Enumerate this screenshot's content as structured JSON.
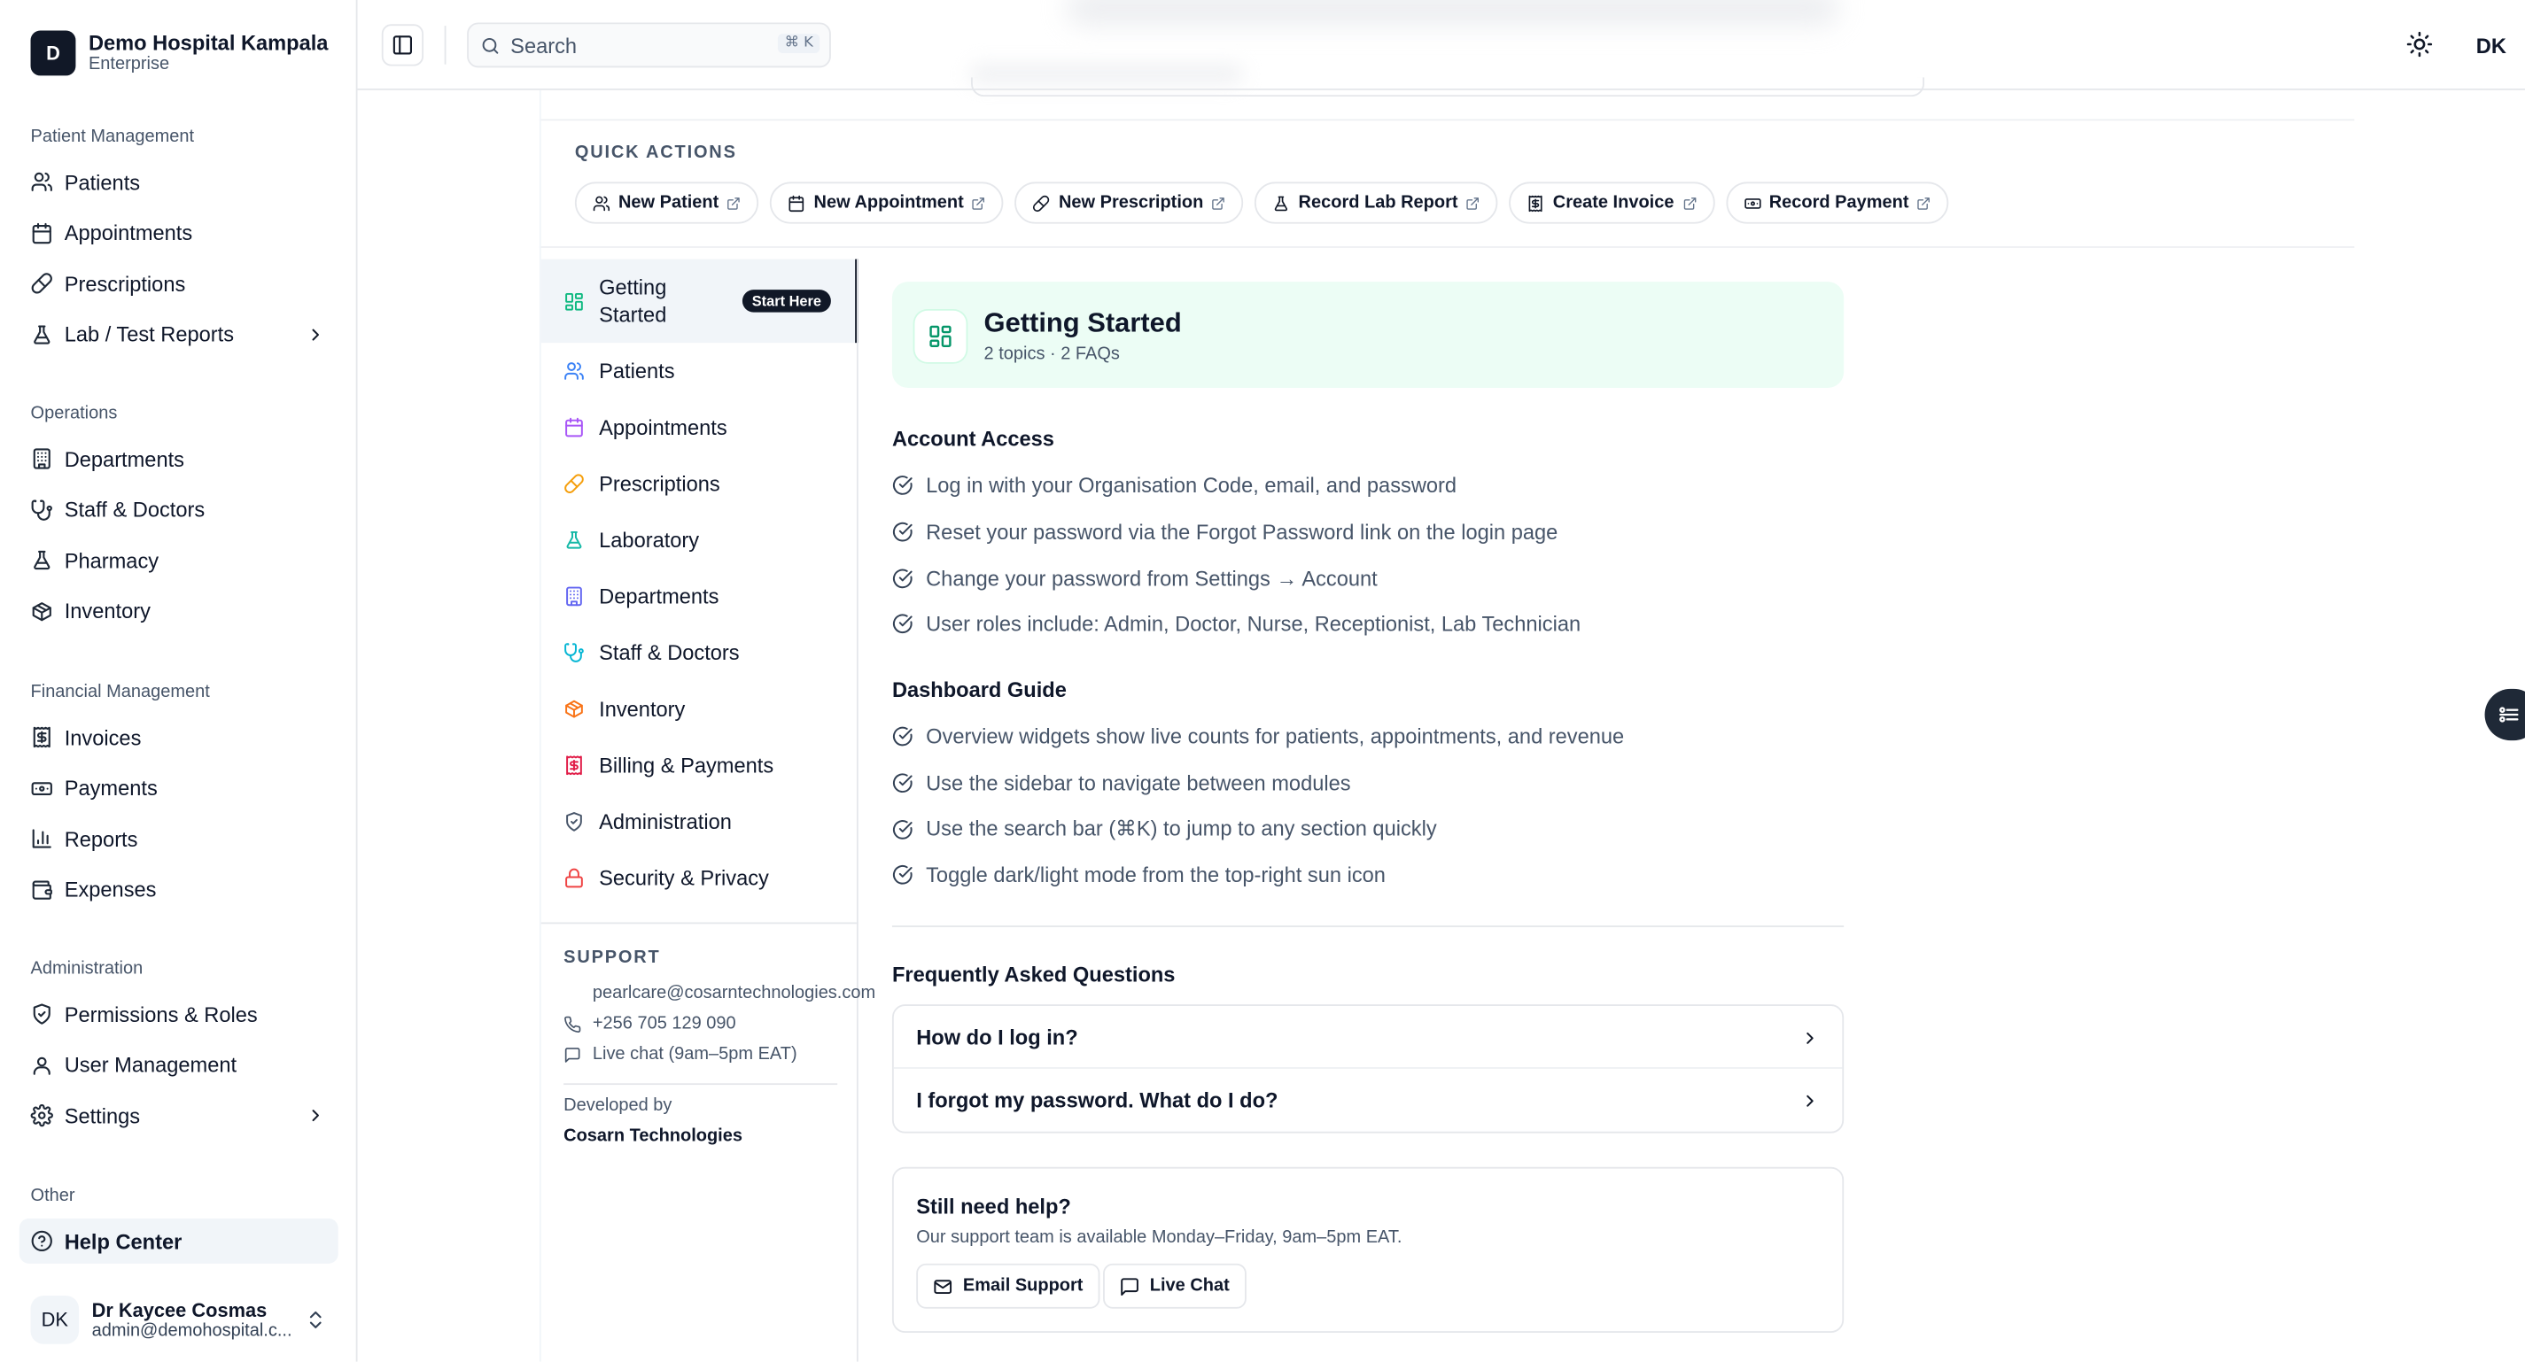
{
  "brand": {
    "logo_letter": "D",
    "name": "Demo Hospital Kampala",
    "plan": "Enterprise"
  },
  "sidebar": {
    "groups": [
      {
        "title": "Patient Management",
        "items": [
          {
            "label": "Patients",
            "icon": "users-icon"
          },
          {
            "label": "Appointments",
            "icon": "calendar-icon"
          },
          {
            "label": "Prescriptions",
            "icon": "pill-icon"
          },
          {
            "label": "Lab / Test Reports",
            "icon": "flask-icon",
            "expandable": true
          }
        ]
      },
      {
        "title": "Operations",
        "items": [
          {
            "label": "Departments",
            "icon": "building-icon"
          },
          {
            "label": "Staff & Doctors",
            "icon": "stethoscope-icon"
          },
          {
            "label": "Pharmacy",
            "icon": "flask-icon"
          },
          {
            "label": "Inventory",
            "icon": "package-icon"
          }
        ]
      },
      {
        "title": "Financial Management",
        "items": [
          {
            "label": "Invoices",
            "icon": "receipt-icon"
          },
          {
            "label": "Payments",
            "icon": "banknote-icon"
          },
          {
            "label": "Reports",
            "icon": "bar-chart-icon"
          },
          {
            "label": "Expenses",
            "icon": "wallet-icon"
          }
        ]
      },
      {
        "title": "Administration",
        "items": [
          {
            "label": "Permissions & Roles",
            "icon": "shield-check-icon"
          },
          {
            "label": "User Management",
            "icon": "user-icon"
          },
          {
            "label": "Settings",
            "icon": "gear-icon",
            "expandable": true
          }
        ]
      },
      {
        "title": "Other",
        "items": [
          {
            "label": "Help Center",
            "icon": "help-circle-icon",
            "active": true
          }
        ]
      }
    ]
  },
  "user": {
    "initials": "DK",
    "name": "Dr Kaycee Cosmas",
    "email": "admin@demohospital.c..."
  },
  "topbar": {
    "search_placeholder": "Search",
    "search_shortcut": "⌘ K",
    "avatar_initials": "DK"
  },
  "quick_actions": {
    "title": "QUICK ACTIONS",
    "items": [
      {
        "label": "New Patient",
        "icon": "users-icon"
      },
      {
        "label": "New Appointment",
        "icon": "calendar-icon"
      },
      {
        "label": "New Prescription",
        "icon": "pill-icon"
      },
      {
        "label": "Record Lab Report",
        "icon": "flask-icon"
      },
      {
        "label": "Create Invoice",
        "icon": "receipt-icon"
      },
      {
        "label": "Record Payment",
        "icon": "banknote-icon"
      }
    ]
  },
  "topics": {
    "active_badge": "Start Here",
    "items": [
      {
        "label": "Getting Started",
        "icon": "grid-icon",
        "color": "#10b981",
        "active": true
      },
      {
        "label": "Patients",
        "icon": "users-icon",
        "color": "#3b82f6"
      },
      {
        "label": "Appointments",
        "icon": "calendar-icon",
        "color": "#a855f7"
      },
      {
        "label": "Prescriptions",
        "icon": "pill-icon",
        "color": "#f59e0b"
      },
      {
        "label": "Laboratory",
        "icon": "flask-icon",
        "color": "#14b8a6"
      },
      {
        "label": "Departments",
        "icon": "building-icon",
        "color": "#6366f1"
      },
      {
        "label": "Staff & Doctors",
        "icon": "stethoscope-icon",
        "color": "#06b6d4"
      },
      {
        "label": "Inventory",
        "icon": "package-icon",
        "color": "#f97316"
      },
      {
        "label": "Billing & Payments",
        "icon": "receipt-icon",
        "color": "#e11d48"
      },
      {
        "label": "Administration",
        "icon": "shield-check-icon",
        "color": "#475569"
      },
      {
        "label": "Security & Privacy",
        "icon": "lock-icon",
        "color": "#ef4444"
      }
    ]
  },
  "support": {
    "title": "SUPPORT",
    "email": "pearlcare@cosarntechnologies.com",
    "phone": "+256 705 129 090",
    "chat": "Live chat (9am–5pm EAT)",
    "developed_by": "Developed by",
    "developer": "Cosarn Technologies"
  },
  "main": {
    "title": "Getting Started",
    "subtitle": "2 topics · 2 FAQs",
    "sections": [
      {
        "title": "Account Access",
        "items": [
          "Log in with your Organisation Code, email, and password",
          "Reset your password via the Forgot Password link on the login page",
          "Change your password from Settings → Account",
          "User roles include: Admin, Doctor, Nurse, Receptionist, Lab Technician"
        ]
      },
      {
        "title": "Dashboard Guide",
        "items": [
          "Overview widgets show live counts for patients, appointments, and revenue",
          "Use the sidebar to navigate between modules",
          "Use the search bar (⌘K) to jump to any section quickly",
          "Toggle dark/light mode from the top-right sun icon"
        ]
      }
    ],
    "faq_title": "Frequently Asked Questions",
    "faqs": [
      "How do I log in?",
      "I forgot my password. What do I do?"
    ],
    "help": {
      "title": "Still need help?",
      "subtitle": "Our support team is available Monday–Friday, 9am–5pm EAT.",
      "email_btn": "Email Support",
      "chat_btn": "Live Chat"
    }
  }
}
